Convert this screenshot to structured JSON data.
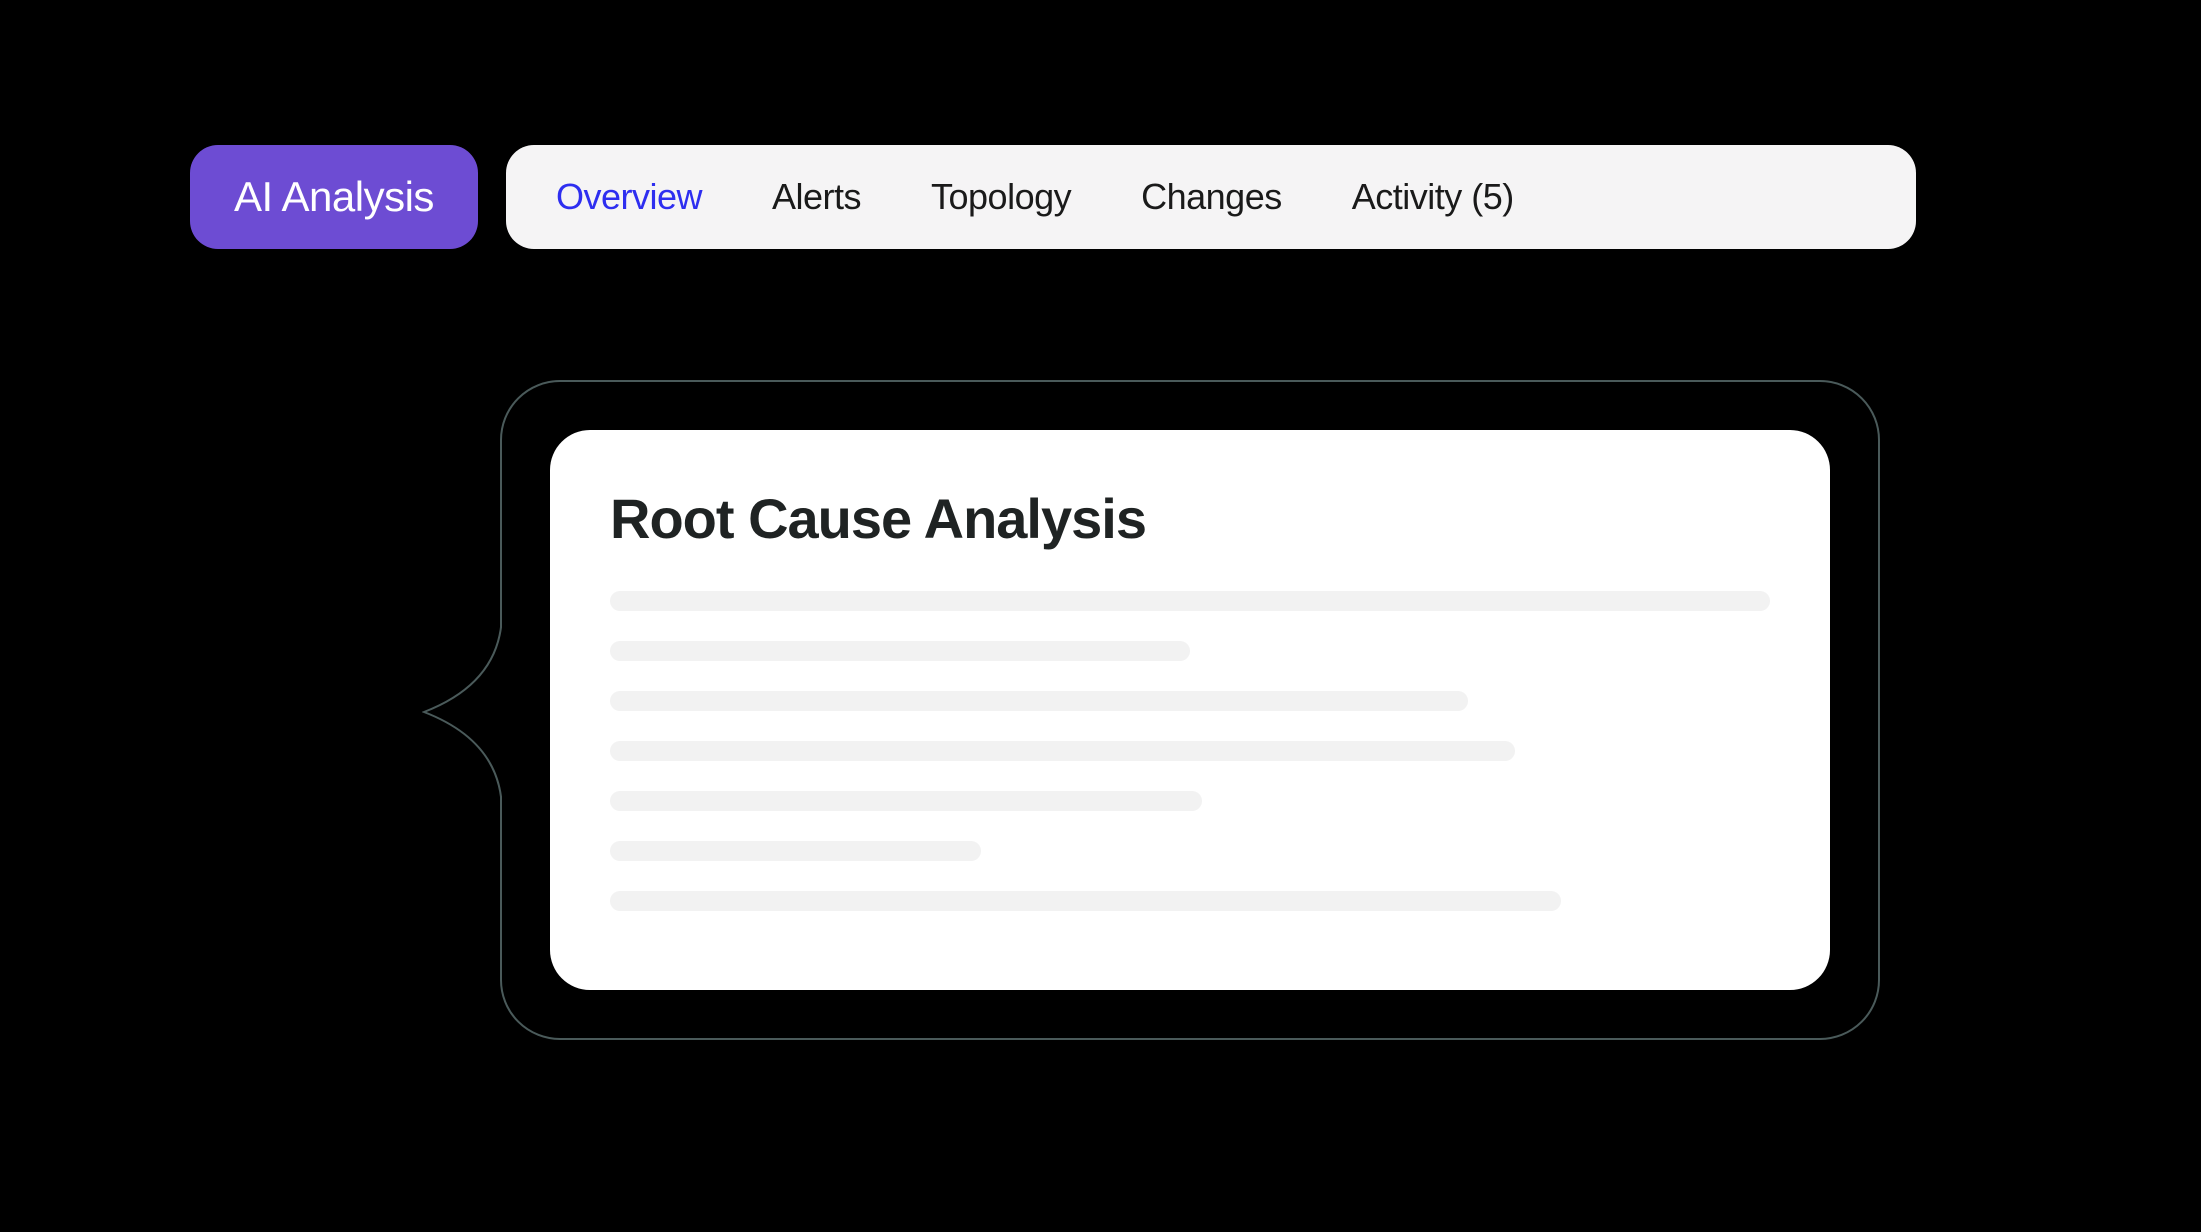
{
  "header": {
    "ai_button_label": "AI Analysis",
    "tabs": [
      {
        "label": "Overview",
        "active": true
      },
      {
        "label": "Alerts",
        "active": false
      },
      {
        "label": "Topology",
        "active": false
      },
      {
        "label": "Changes",
        "active": false
      },
      {
        "label": "Activity (5)",
        "active": false
      }
    ]
  },
  "card": {
    "title": "Root Cause Analysis"
  },
  "colors": {
    "accent_purple": "#6d4cd3",
    "active_blue": "#2e2ef0",
    "tab_bg": "#f5f4f5",
    "bubble_border": "#4a5a5a",
    "skeleton_bg": "#f2f2f2"
  }
}
